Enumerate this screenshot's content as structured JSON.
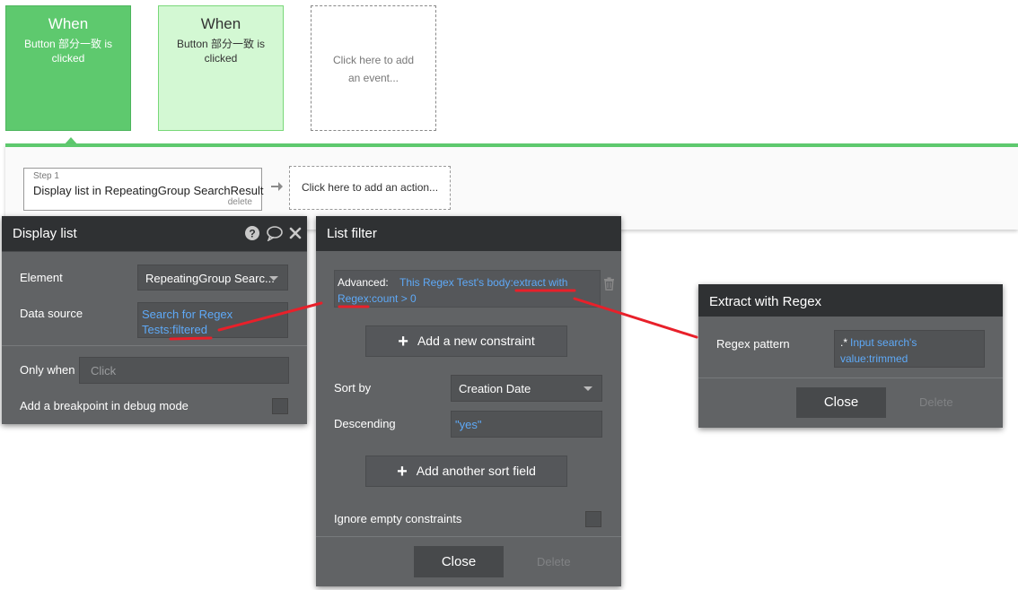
{
  "events": [
    {
      "title": "When",
      "text": "Button 部分一致 is clicked"
    },
    {
      "title": "When",
      "text": "Button 部分一致 is clicked"
    },
    {
      "text": "Click here to add an event..."
    }
  ],
  "workflow": {
    "step_label": "Step 1",
    "step_text": "Display list in RepeatingGroup SearchResult",
    "step_delete": "delete",
    "add_action": "Click here to add an action..."
  },
  "display_list": {
    "title": "Display list",
    "element_label": "Element",
    "element_value": "RepeatingGroup Searc...",
    "data_source_label": "Data source",
    "data_source_line1": "Search for Regex",
    "data_source_line2": "Tests:filtered",
    "only_when_label": "Only when",
    "only_when_placeholder": "Click",
    "breakpoint_label": "Add a breakpoint in debug mode"
  },
  "list_filter": {
    "title": "List filter",
    "advanced_label": "Advanced:",
    "advanced_expr_line1": "This Regex Test's body:extract with",
    "advanced_expr_line2": "Regex:count > 0",
    "add_constraint": "Add a new constraint",
    "sort_by_label": "Sort by",
    "sort_by_value": "Creation Date",
    "descending_label": "Descending",
    "descending_value": "\"yes\"",
    "add_sort": "Add another sort field",
    "ignore_empty_label": "Ignore empty constraints",
    "close": "Close",
    "delete": "Delete"
  },
  "extract_regex": {
    "title": "Extract with Regex",
    "pattern_label": "Regex pattern",
    "pattern_prefix": ".*",
    "pattern_line1": "Input search's",
    "pattern_line2": "value:trimmed",
    "close": "Close",
    "delete": "Delete"
  },
  "icons": {
    "help": "question-icon",
    "comment": "speech-bubble-icon",
    "close": "close-icon",
    "trash": "trash-icon",
    "arrow": "arrow-right-icon",
    "plus": "plus-icon"
  },
  "colors": {
    "event_active": "#5ec96e",
    "event_light": "#d3f8d3",
    "panel_bg": "#616365",
    "panel_header": "#2f3133",
    "link_blue": "#5ea9f7",
    "annotation_red": "#e8202a"
  }
}
